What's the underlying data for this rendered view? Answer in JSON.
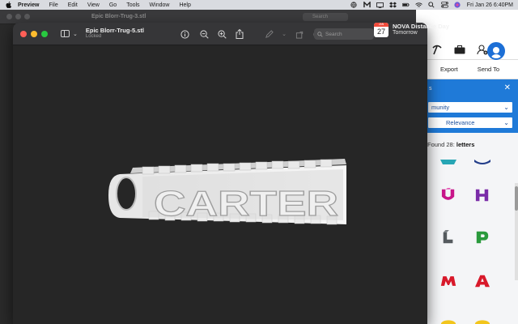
{
  "menubar": {
    "app": "Preview",
    "items": [
      "File",
      "Edit",
      "View",
      "Go",
      "Tools",
      "Window",
      "Help"
    ],
    "datetime": "Fri Jan 26  6:40PM"
  },
  "background_window": {
    "title": "Epic Blorr-Trug-3.stl",
    "search_placeholder": "Search"
  },
  "main_window": {
    "title": "Epic Blorr-Trug-5.stl",
    "subtitle": "Locked",
    "search_placeholder": "Search",
    "model_text": "CARTER"
  },
  "notification": {
    "month": "JAN",
    "day": "27",
    "title": "NOVA Distance Day",
    "subtitle": "Tomorrow"
  },
  "side_app": {
    "actions": [
      "Export",
      "Send To"
    ],
    "panel_header": "s",
    "source_select": "munity",
    "sort_select": "Relevance",
    "found_prefix": "Found 28: ",
    "found_term": "letters",
    "shapes": [
      {
        "name": "teal-shape",
        "color": "#27a6b5"
      },
      {
        "name": "navy-shape",
        "color": "#233e8a"
      },
      {
        "name": "letter-u-shape",
        "color": "#c8168a"
      },
      {
        "name": "letter-h-shape",
        "color": "#7a2ca8"
      },
      {
        "name": "letter-l-shape",
        "color": "#555a5e"
      },
      {
        "name": "letter-p-shape",
        "color": "#2a9a3c"
      },
      {
        "name": "letter-m-shape",
        "color": "#d8192a"
      },
      {
        "name": "letter-a-shape",
        "color": "#d8192a"
      },
      {
        "name": "yellow-shape-1",
        "color": "#f2c51c"
      },
      {
        "name": "yellow-shape-2",
        "color": "#f2c51c"
      }
    ]
  }
}
